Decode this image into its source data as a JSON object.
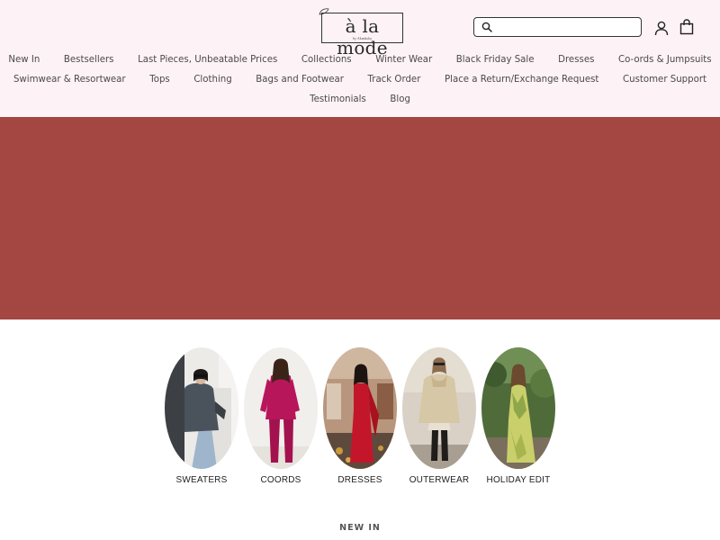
{
  "brand": {
    "logo_text": "à la mode",
    "logo_subtext": "by Akanksha",
    "bg_color": "#fdf2f6"
  },
  "search": {
    "placeholder": "",
    "value": ""
  },
  "header_icons": [
    "search-icon",
    "account-icon",
    "cart-icon"
  ],
  "nav": {
    "row1": [
      "New In",
      "Bestsellers",
      "Last Pieces, Unbeatable Prices",
      "Collections",
      "Winter Wear",
      "Black Friday Sale",
      "Dresses",
      "Co-ords & Jumpsuits"
    ],
    "row2": [
      "Swimwear & Resortwear",
      "Tops",
      "Clothing",
      "Bags and Footwear",
      "Track Order",
      "Place a Return/Exchange Request",
      "Customer Support"
    ],
    "row3": [
      "Testimonials",
      "Blog"
    ]
  },
  "hero": {
    "color": "#a44641"
  },
  "collections": [
    {
      "label": "SWEATERS"
    },
    {
      "label": "COORDS"
    },
    {
      "label": "DRESSES"
    },
    {
      "label": "OUTERWEAR"
    },
    {
      "label": "HOLIDAY EDIT"
    }
  ],
  "section": {
    "title": "NEW IN"
  }
}
